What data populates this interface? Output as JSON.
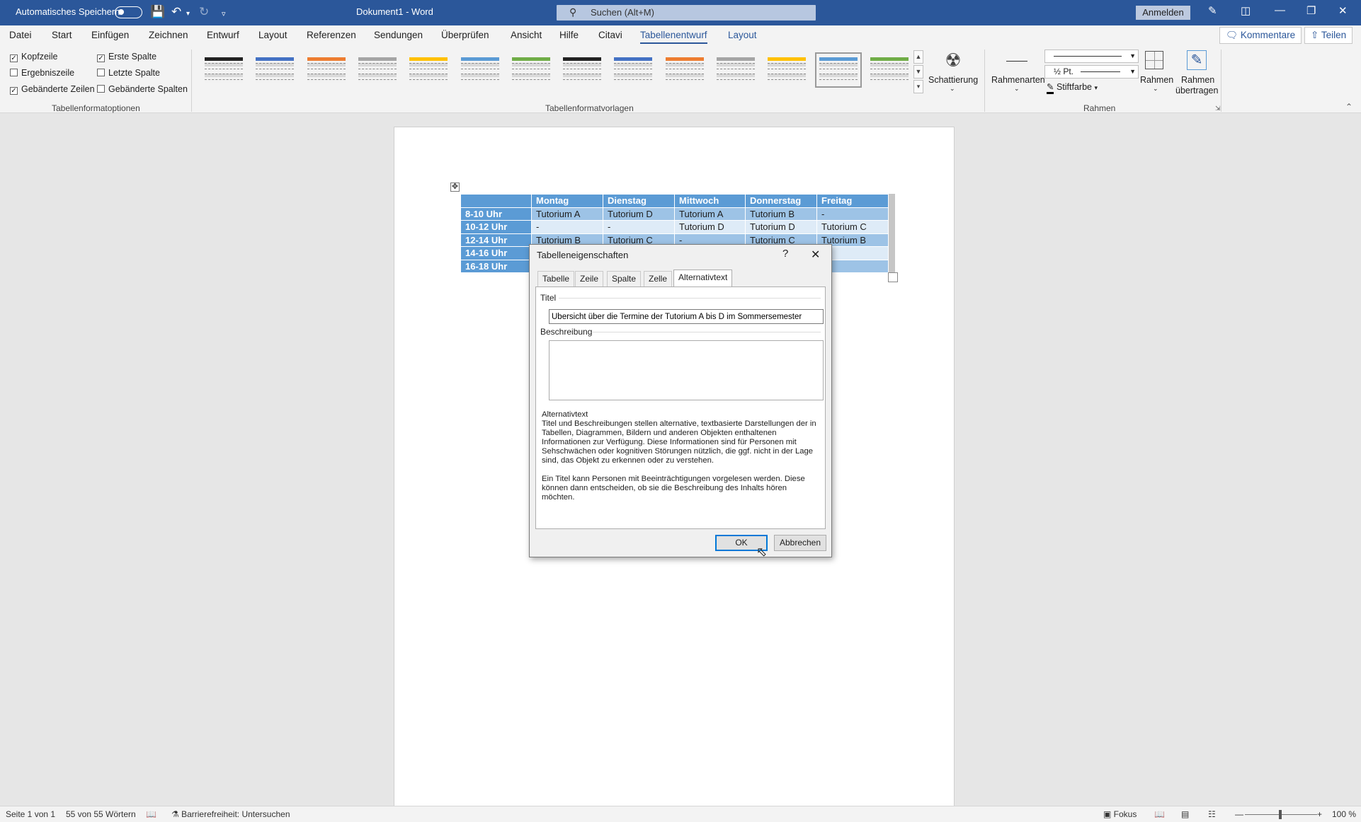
{
  "titlebar": {
    "autosave_label": "Automatisches Speichern",
    "doc_title": "Dokument1  -  Word",
    "search_placeholder": "Suchen (Alt+M)",
    "signin_label": "Anmelden"
  },
  "menu": {
    "items": [
      "Datei",
      "Start",
      "Einfügen",
      "Zeichnen",
      "Entwurf",
      "Layout",
      "Referenzen",
      "Sendungen",
      "Überprüfen",
      "Ansicht",
      "Hilfe",
      "Citavi",
      "Tabellenentwurf",
      "Layout"
    ],
    "active_index": 12,
    "comments_label": "Kommentare",
    "share_label": "Teilen"
  },
  "ribbon": {
    "options": [
      {
        "label": "Kopfzeile",
        "checked": true
      },
      {
        "label": "Ergebniszeile",
        "checked": false
      },
      {
        "label": "Gebänderte Zeilen",
        "checked": true
      },
      {
        "label": "Erste Spalte",
        "checked": true
      },
      {
        "label": "Letzte Spalte",
        "checked": false
      },
      {
        "label": "Gebänderte Spalten",
        "checked": false
      }
    ],
    "group_options": "Tabellenformatoptionen",
    "group_styles": "Tabellenformatvorlagen",
    "group_borders": "Rahmen",
    "shading_label": "Schattierung",
    "border_styles_label": "Rahmenarten",
    "pen_weight": "½ Pt.",
    "pen_color_label": "Stiftfarbe",
    "borders_label": "Rahmen",
    "painter_label_1": "Rahmen",
    "painter_label_2": "übertragen",
    "style_colors": [
      "#222222",
      "#4472c4",
      "#ed7d31",
      "#a5a5a5",
      "#ffc000",
      "#5b9bd5",
      "#70ad47",
      "#222222",
      "#4472c4",
      "#ed7d31",
      "#a5a5a5",
      "#ffc000",
      "#5b9bd5",
      "#70ad47"
    ],
    "selected_style": 12
  },
  "table": {
    "headers": [
      "",
      "Montag",
      "Dienstag",
      "Mittwoch",
      "Donnerstag",
      "Freitag"
    ],
    "rows": [
      [
        "8-10 Uhr",
        "Tutorium A",
        "Tutorium D",
        "Tutorium A",
        "Tutorium B",
        "-"
      ],
      [
        "10-12 Uhr",
        "-",
        "-",
        "Tutorium D",
        "Tutorium D",
        "Tutorium C"
      ],
      [
        "12-14 Uhr",
        "Tutorium B",
        "Tutorium C",
        "-",
        "Tutorium C",
        "Tutorium B"
      ],
      [
        "14-16 Uhr",
        "",
        "",
        "",
        "",
        ""
      ],
      [
        "16-18 Uhr",
        "",
        "",
        "",
        "",
        ""
      ]
    ]
  },
  "dialog": {
    "title": "Tabelleneigenschaften",
    "help": "?",
    "tabs": [
      "Tabelle",
      "Zeile",
      "Spalte",
      "Zelle",
      "Alternativtext"
    ],
    "active_tab": 4,
    "title_label": "Titel",
    "title_value": "Übersicht über die Termine der Tutorium A bis D im Sommersemester",
    "desc_label": "Beschreibung",
    "desc_value": "",
    "info_heading": "Alternativtext",
    "info_p1": "Titel und Beschreibungen stellen alternative, textbasierte Darstellungen der in Tabellen, Diagrammen, Bildern und anderen Objekten enthaltenen Informationen zur Verfügung. Diese Informationen sind für Personen mit Sehschwächen oder kognitiven Störungen nützlich, die ggf. nicht in der Lage sind, das Objekt zu erkennen oder zu verstehen.",
    "info_p2": "Ein Titel kann Personen mit Beeinträchtigungen vorgelesen werden. Diese können dann entscheiden, ob sie die Beschreibung des Inhalts hören möchten.",
    "ok_label": "OK",
    "cancel_label": "Abbrechen"
  },
  "status": {
    "page": "Seite 1 von 1",
    "words": "55 von 55 Wörtern",
    "accessibility": "Barrierefreiheit: Untersuchen",
    "focus": "Fokus",
    "zoom": "100 %"
  }
}
